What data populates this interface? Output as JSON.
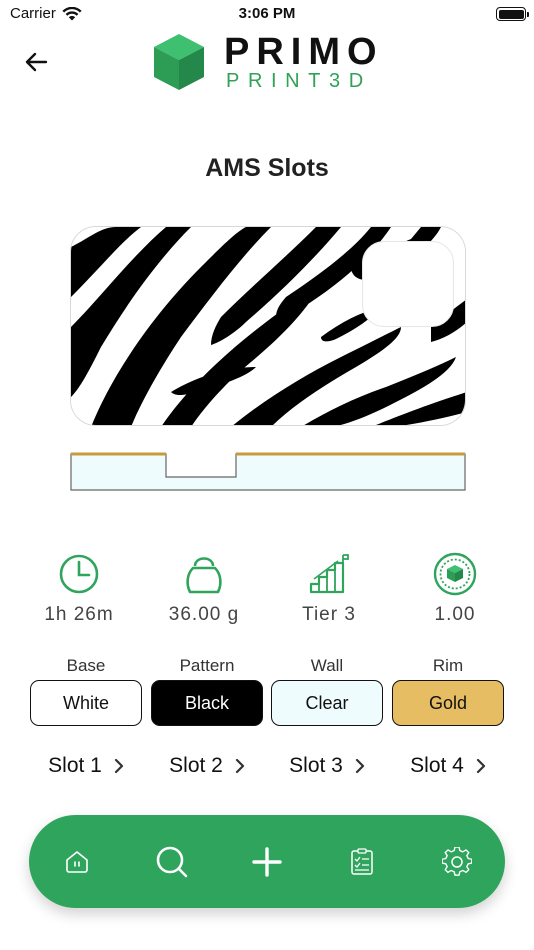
{
  "status_bar": {
    "carrier": "Carrier",
    "time": "3:06 PM"
  },
  "header": {
    "logo_primary": "PRIMO",
    "logo_secondary": "PRINT3D",
    "back_icon": "arrow-left-icon"
  },
  "page": {
    "title": "AMS Slots"
  },
  "stats": [
    {
      "icon": "clock-icon",
      "value": "1h 26m"
    },
    {
      "icon": "kettlebell-icon",
      "value": "36.00 g"
    },
    {
      "icon": "tier-stairs-icon",
      "value": "Tier 3"
    },
    {
      "icon": "scale-badge-icon",
      "value": "1.00"
    }
  ],
  "layers": [
    {
      "label": "Base",
      "color_name": "White",
      "color": "#ffffff",
      "text_color": "#111111"
    },
    {
      "label": "Pattern",
      "color_name": "Black",
      "color": "#000000",
      "text_color": "#ffffff"
    },
    {
      "label": "Wall",
      "color_name": "Clear",
      "color": "#eefcfd",
      "text_color": "#111111"
    },
    {
      "label": "Rim",
      "color_name": "Gold",
      "color": "#e6bd62",
      "text_color": "#111111"
    }
  ],
  "slots": [
    "Slot 1",
    "Slot 2",
    "Slot 3",
    "Slot 4"
  ],
  "bottom_nav": [
    {
      "name": "home",
      "icon": "home-icon"
    },
    {
      "name": "search",
      "icon": "search-icon"
    },
    {
      "name": "create",
      "icon": "plus-icon"
    },
    {
      "name": "orders",
      "icon": "checklist-icon"
    },
    {
      "name": "settings",
      "icon": "gear-icon"
    }
  ],
  "colors": {
    "brand_green": "#2fa45d",
    "logo_green": "#2fa257",
    "gold": "#e6bd62",
    "clear": "#eefcfd"
  }
}
